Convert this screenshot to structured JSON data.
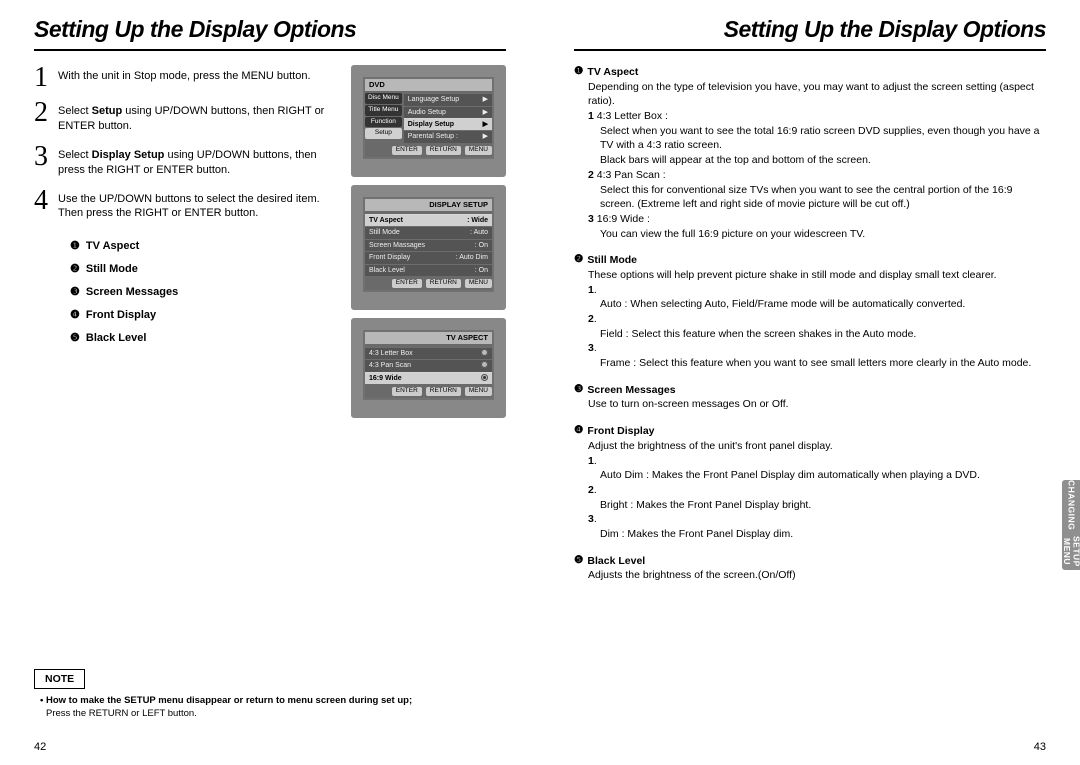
{
  "meta": {
    "page_left": "42",
    "page_right": "43"
  },
  "left": {
    "title": "Setting Up the Display Options",
    "steps": [
      {
        "num": "1",
        "text": "With the unit in Stop mode, press the MENU button."
      },
      {
        "num": "2",
        "text_pre": "Select ",
        "bold": "Setup",
        "text_post": " using UP/DOWN buttons, then RIGHT or ENTER button."
      },
      {
        "num": "3",
        "text_pre": "Select ",
        "bold": "Display Setup",
        "text_post": " using UP/DOWN buttons, then press the RIGHT or ENTER button."
      },
      {
        "num": "4",
        "text": "Use the UP/DOWN buttons to select the desired item. Then press the RIGHT or ENTER button."
      }
    ],
    "options": [
      {
        "marker": "❶",
        "label": "TV Aspect"
      },
      {
        "marker": "❷",
        "label": "Still Mode"
      },
      {
        "marker": "❸",
        "label": "Screen Messages"
      },
      {
        "marker": "❹",
        "label": "Front Display"
      },
      {
        "marker": "❺",
        "label": "Black Level"
      }
    ],
    "screen1": {
      "header": "DVD",
      "sidebar": [
        "Disc Menu",
        "Title Menu",
        "Function",
        "Setup"
      ],
      "list": [
        {
          "l": "Language Setup",
          "r": "▶"
        },
        {
          "l": "Audio Setup",
          "r": "▶"
        },
        {
          "l": "Display Setup",
          "r": "▶",
          "hl": true
        },
        {
          "l": "Parental Setup :",
          "r": "▶"
        }
      ],
      "buttons": [
        "ENTER",
        "RETURN",
        "MENU"
      ]
    },
    "screen2": {
      "header": "DISPLAY SETUP",
      "list": [
        {
          "l": "TV Aspect",
          "r": ": Wide",
          "hl": true
        },
        {
          "l": "Still Mode",
          "r": ": Auto"
        },
        {
          "l": "Screen Massages",
          "r": ": On"
        },
        {
          "l": "Front Display",
          "r": ": Auto Dim"
        },
        {
          "l": "Black Level",
          "r": ": On"
        }
      ],
      "buttons": [
        "ENTER",
        "RETURN",
        "MENU"
      ]
    },
    "screen3": {
      "header": "TV ASPECT",
      "rows": [
        {
          "l": "4:3 Letter Box",
          "sel": false
        },
        {
          "l": "4:3 Pan Scan",
          "sel": false
        },
        {
          "l": "16:9 Wide",
          "sel": true,
          "hl": true
        }
      ],
      "buttons": [
        "ENTER",
        "RETURN",
        "MENU"
      ]
    },
    "note": {
      "label": "NOTE",
      "line1": "• How to make the SETUP menu disappear or return to menu screen during set up;",
      "line2": "Press the RETURN or LEFT button."
    }
  },
  "right": {
    "title": "Setting Up the Display Options",
    "tab_line1": "CHANGING",
    "tab_line2": "SETUP MENU",
    "sections": [
      {
        "marker": "❶",
        "head": "TV Aspect",
        "intro": "Depending on the type of television you have, you may want to adjust the screen setting (aspect ratio).",
        "items": [
          {
            "num": "1",
            "head": "4:3 Letter Box :",
            "body": "Select when you want to see the total 16:9 ratio screen DVD supplies, even though you have a TV with a 4:3 ratio screen.\nBlack bars will appear at the top and bottom of the screen."
          },
          {
            "num": "2",
            "head": "4:3 Pan Scan :",
            "body": "Select this for conventional size TVs when you want to see the central portion of the 16:9 screen. (Extreme left and right side of movie picture will be cut off.)"
          },
          {
            "num": "3",
            "head": "16:9 Wide :",
            "body": "You can view the full 16:9 picture on your widescreen TV."
          }
        ]
      },
      {
        "marker": "❷",
        "head": "Still Mode",
        "intro": "These options will help prevent picture shake in still mode and display small text clearer.",
        "items": [
          {
            "num": "1",
            "head": "",
            "body": "Auto : When selecting Auto, Field/Frame mode will be automatically converted."
          },
          {
            "num": "2",
            "head": "",
            "body": "Field : Select this feature when the screen shakes in the Auto mode."
          },
          {
            "num": "3",
            "head": "",
            "body": "Frame : Select this feature when you want to see small letters more clearly in the Auto mode."
          }
        ]
      },
      {
        "marker": "❸",
        "head": "Screen Messages",
        "intro": "Use to turn on-screen messages On or Off.",
        "items": []
      },
      {
        "marker": "❹",
        "head": "Front Display",
        "intro": "Adjust the brightness of the unit's front panel display.",
        "items": [
          {
            "num": "1",
            "head": "",
            "body": "Auto Dim : Makes the Front Panel Display dim automatically when playing a DVD."
          },
          {
            "num": "2",
            "head": "",
            "body": "Bright : Makes the Front Panel Display bright."
          },
          {
            "num": "3",
            "head": "",
            "body": "Dim : Makes the Front Panel Display dim."
          }
        ]
      },
      {
        "marker": "❺",
        "head": "Black Level",
        "intro": "Adjusts the brightness of the screen.(On/Off)",
        "items": []
      }
    ]
  }
}
